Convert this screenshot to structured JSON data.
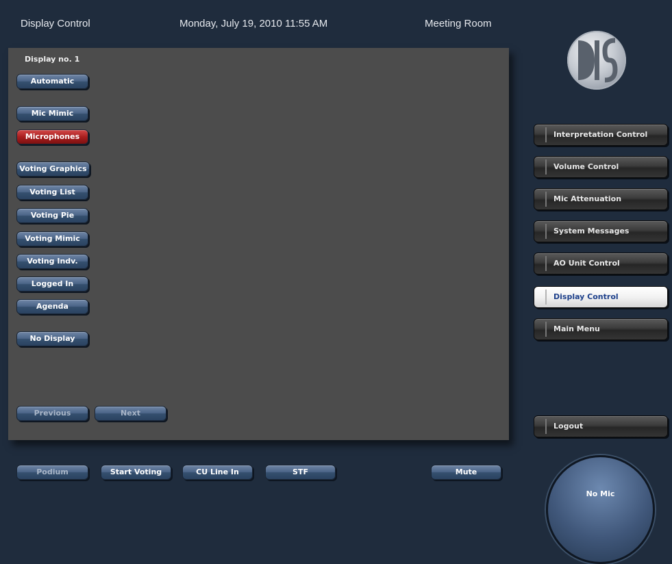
{
  "header": {
    "title": "Display Control",
    "datetime": "Monday, July 19, 2010 11:55 AM",
    "location": "Meeting Room"
  },
  "panel": {
    "label": "Display no. 1",
    "buttons": {
      "automatic": "Automatic",
      "mic_mimic": "Mic Mimic",
      "microphones": "Microphones",
      "voting_graphics": "Voting Graphics",
      "voting_list": "Voting List",
      "voting_pie": "Voting Pie",
      "voting_mimic": "Voting Mimic",
      "voting_indv": "Voting Indv.",
      "logged_in": "Logged In",
      "agenda": "Agenda",
      "no_display": "No Display",
      "previous": "Previous",
      "next": "Next"
    },
    "active_button": "Microphones"
  },
  "menu": {
    "items": [
      "Interpretation Control",
      "Volume Control",
      "Mic Attenuation",
      "System Messages",
      "AO Unit Control",
      "Display Control",
      "Main Menu"
    ],
    "selected": "Display Control",
    "logout": "Logout"
  },
  "footer": {
    "podium": "Podium",
    "start_voting": "Start Voting",
    "cu_line_in": "CU Line In",
    "stf": "STF",
    "mute": "Mute",
    "no_mic": "No Mic"
  },
  "colors": {
    "background": "#1f2c3d",
    "panel": "#4c4c4c",
    "button_blue": "#4b6487",
    "button_active_red": "#a91f1f",
    "menu_selected": "#ffffff"
  },
  "icons": {
    "logo": "dis-logo"
  }
}
